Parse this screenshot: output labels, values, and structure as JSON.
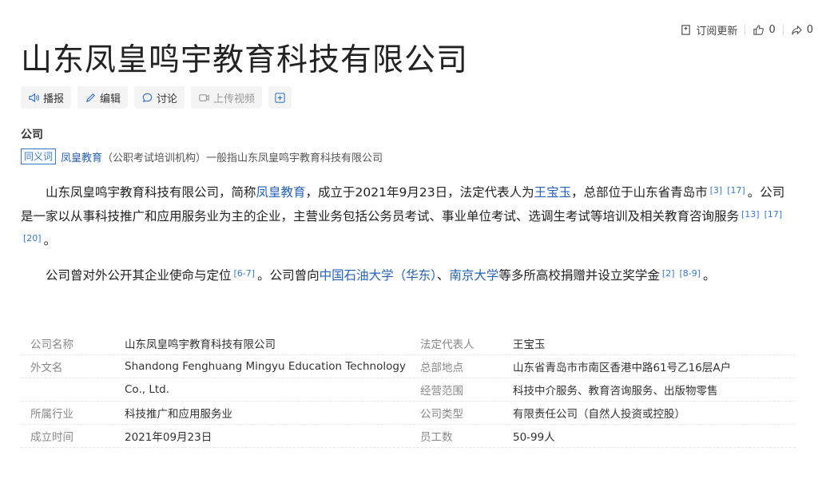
{
  "top_actions": {
    "subscribe": "订阅更新",
    "likes": "0",
    "shares": "0"
  },
  "title": "山东凤皇鸣宇教育科技有限公司",
  "toolbar": {
    "broadcast": "播报",
    "edit": "编辑",
    "discuss": "讨论",
    "upload_video": "上传视频",
    "add": "+"
  },
  "section_label": "公司",
  "synonym": {
    "tag": "同义词",
    "term": "凤皇教育",
    "rest": "（公职考试培训机构）一般指山东凤皇鸣宇教育科技有限公司"
  },
  "para1": {
    "t1": "山东凤皇鸣宇教育科技有限公司，简称",
    "link1": "凤皇教育",
    "t2": "，成立于2021年9月23日，法定代表人为",
    "link2": "王宝玉",
    "t3": "，总部位于山东省青岛市",
    "refs1": [
      "[3]",
      "[17]"
    ],
    "t4": "。公司是一家以从事科技推广和应用服务业为主的企业，主营业务包括公务员考试、事业单位考试、选调生考试等培训及相关教育咨询服务",
    "refs2": [
      "[13]",
      "[17]",
      "[20]"
    ],
    "t5": "。"
  },
  "para2": {
    "t1": "公司曾对外公开其企业使命与定位",
    "ref1": "[6-7]",
    "t2": "。公司曾向",
    "link1": "中国石油大学（华东）",
    "t3": "、",
    "link2": "南京大学",
    "t4": "等多所高校捐赠并设立奖学金",
    "refs2": [
      "[2]",
      "[8-9]"
    ],
    "t5": "。"
  },
  "info_rows": [
    {
      "k": "公司名称",
      "v": "山东凤皇鸣宇教育科技有限公司",
      "k2": "法定代表人",
      "v2": "王宝玉"
    },
    {
      "k": "外文名",
      "v": "Shandong Fenghuang Mingyu Education Technology",
      "k2": "总部地点",
      "v2": "山东省青岛市市南区香港中路61号乙16层A户"
    },
    {
      "k": "",
      "v": "Co., Ltd.",
      "k2": "经营范围",
      "v2": "科技中介服务、教育咨询服务、出版物零售"
    },
    {
      "k": "所属行业",
      "v": "科技推广和应用服务业",
      "k2": "公司类型",
      "v2": "有限责任公司（自然人投资或控股）"
    },
    {
      "k": "成立时间",
      "v": "2021年09月23日",
      "k2": "员工数",
      "v2": "50-99人"
    }
  ]
}
